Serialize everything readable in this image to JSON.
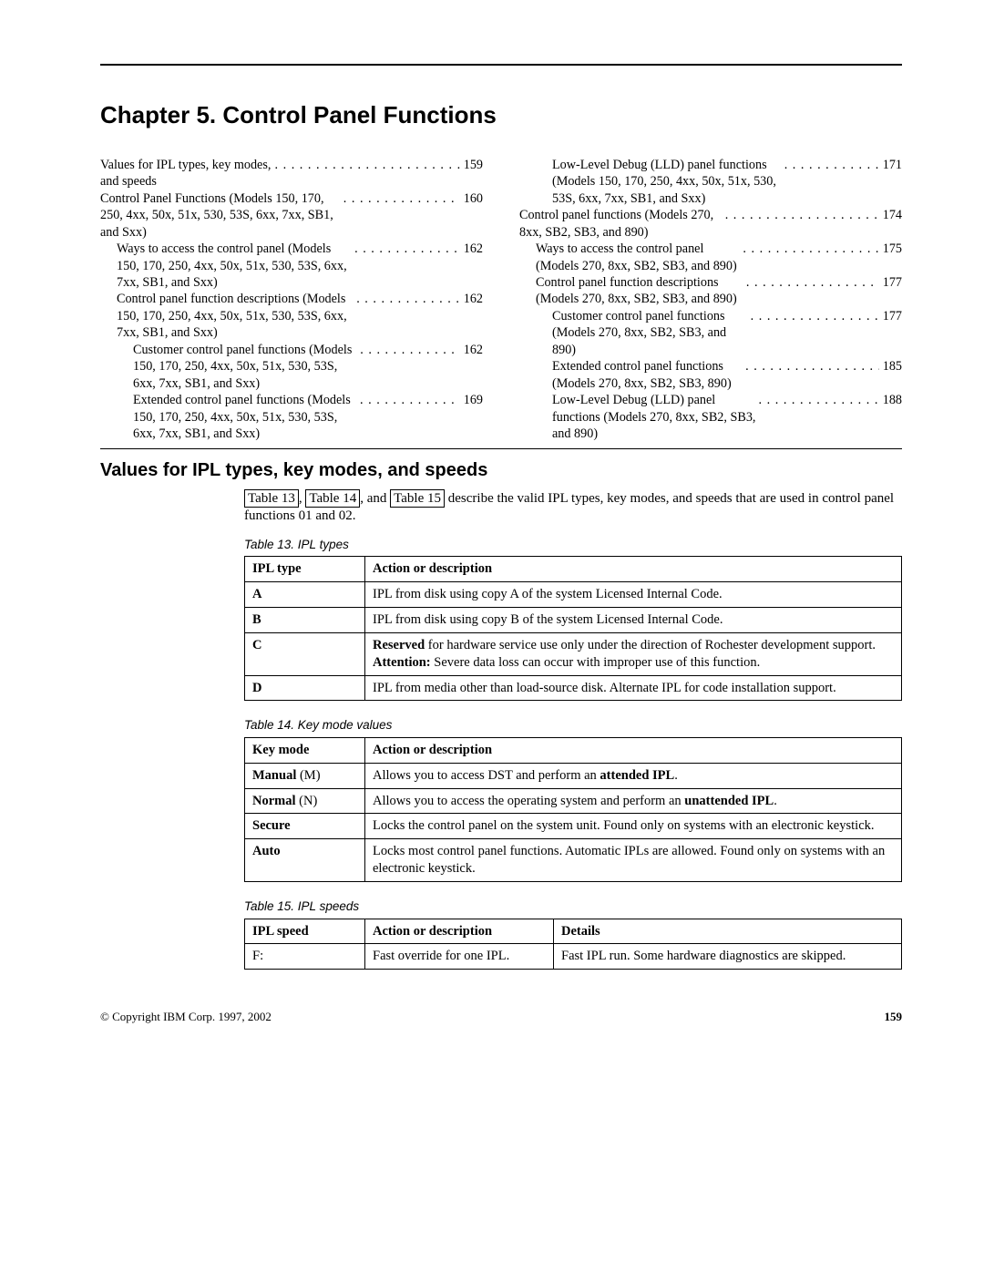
{
  "chapter_title": "Chapter 5. Control Panel Functions",
  "toc": {
    "left": [
      {
        "indent": 0,
        "text": "Values for IPL types, key modes, and speeds",
        "page": "159",
        "wrap": ""
      },
      {
        "indent": 0,
        "text": "Control Panel Functions (Models 150, 170, 250, 4xx, 50x, 51x, 530, 53S, 6xx, 7xx, SB1, and Sxx)",
        "page": "160",
        "wrap": ""
      },
      {
        "indent": 1,
        "text": "Ways to access the control panel (Models 150, 170, 250, 4xx, 50x, 51x, 530, 53S, 6xx, 7xx, SB1, and Sxx)",
        "page": "162",
        "wrap": ""
      },
      {
        "indent": 1,
        "text": "Control panel function descriptions (Models 150, 170, 250, 4xx, 50x, 51x, 530, 53S, 6xx, 7xx, SB1, and Sxx)",
        "page": "162",
        "wrap": ""
      },
      {
        "indent": 2,
        "text": "Customer control panel functions (Models 150, 170, 250, 4xx, 50x, 51x, 530, 53S, 6xx, 7xx, SB1, and Sxx)",
        "page": "162",
        "wrap": ""
      },
      {
        "indent": 2,
        "text": "Extended control panel functions (Models 150, 170, 250, 4xx, 50x, 51x, 530, 53S, 6xx, 7xx, SB1, and Sxx)",
        "page": "169",
        "wrap": ""
      }
    ],
    "right": [
      {
        "indent": 2,
        "text": "Low-Level Debug (LLD) panel functions (Models 150, 170, 250, 4xx, 50x, 51x, 530, 53S, 6xx, 7xx, SB1, and Sxx)",
        "page": "171",
        "wrap": ""
      },
      {
        "indent": 0,
        "text": "Control panel functions (Models 270, 8xx, SB2, SB3, and 890)",
        "page": "174",
        "wrap": ""
      },
      {
        "indent": 1,
        "text": "Ways to access the control panel (Models 270, 8xx, SB2, SB3, and 890)",
        "page": "175",
        "wrap": ""
      },
      {
        "indent": 1,
        "text": "Control panel function descriptions (Models 270, 8xx, SB2, SB3, and 890)",
        "page": "177",
        "wrap": ""
      },
      {
        "indent": 2,
        "text": "Customer control panel functions (Models 270, 8xx, SB2, SB3, and 890)",
        "page": "177",
        "wrap": ""
      },
      {
        "indent": 2,
        "text": "Extended control panel functions (Models 270, 8xx, SB2, SB3, 890)",
        "page": "185",
        "wrap": ""
      },
      {
        "indent": 2,
        "text": "Low-Level Debug (LLD) panel functions (Models 270, 8xx, SB2, SB3, and 890)",
        "page": "188",
        "wrap": ""
      }
    ]
  },
  "section_title": "Values for IPL types, key modes, and speeds",
  "intro": {
    "ref1": "Table 13",
    "sep1": ", ",
    "ref2": "Table 14",
    "sep2": ", and ",
    "ref3": "Table 15",
    "tail": " describe the valid IPL types, key modes, and speeds that are used in control panel functions 01 and 02."
  },
  "table13": {
    "caption": "Table 13. IPL types",
    "h1": "IPL type",
    "h2": "Action or description",
    "rows": [
      {
        "k": "A",
        "v": "IPL from disk using copy A of the system Licensed Internal Code."
      },
      {
        "k": "B",
        "v": "IPL from disk using copy B of the system Licensed Internal Code."
      },
      {
        "k": "C",
        "v_html": "<strong>Reserved</strong> for hardware service use only under the direction of Rochester development support. <strong>Attention:</strong> Severe data loss can occur with improper use of this function."
      },
      {
        "k": "D",
        "v": "IPL from media other than load-source disk. Alternate IPL for code installation support."
      }
    ]
  },
  "table14": {
    "caption": "Table 14. Key mode values",
    "h1": "Key mode",
    "h2": "Action or description",
    "rows": [
      {
        "k_html": "<strong>Manual</strong> (M)",
        "v_html": "Allows you to access DST and perform an <strong>attended IPL</strong>."
      },
      {
        "k_html": "<strong>Normal</strong> (N)",
        "v_html": "Allows you to access the operating system and perform an <strong>unattended IPL</strong>."
      },
      {
        "k_html": "<strong>Secure</strong>",
        "v": "Locks the control panel on the system unit. Found only on systems with an electronic keystick."
      },
      {
        "k_html": "<strong>Auto</strong>",
        "v": "Locks most control panel functions. Automatic IPLs are allowed. Found only on systems with an electronic keystick."
      }
    ]
  },
  "table15": {
    "caption": "Table 15. IPL speeds",
    "h1": "IPL speed",
    "h2": "Action or description",
    "h3": "Details",
    "rows": [
      {
        "k": "F:",
        "a": "Fast override for one IPL.",
        "d": "Fast IPL run. Some hardware diagnostics are skipped."
      }
    ]
  },
  "footer": {
    "copyright": "© Copyright IBM Corp. 1997, 2002",
    "page": "159"
  }
}
